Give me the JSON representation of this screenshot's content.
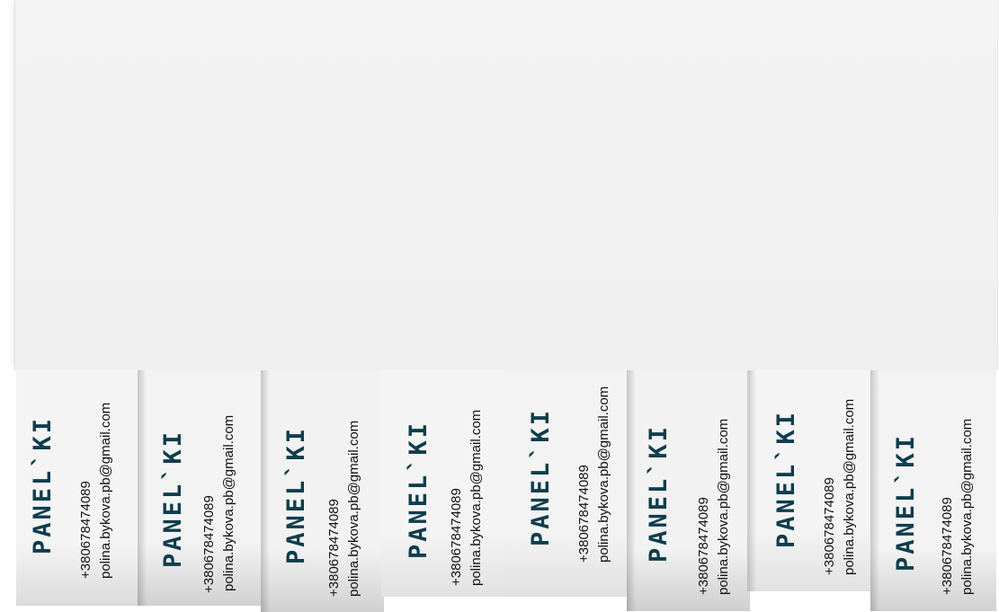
{
  "tabs": [
    {
      "brand": "PANEL`KI",
      "phone": "+380678474089",
      "email": "polina.bykova.pb@gmail.com"
    },
    {
      "brand": "PANEL`KI",
      "phone": "+380678474089",
      "email": "polina.bykova.pb@gmail.com"
    },
    {
      "brand": "PANEL`KI",
      "phone": "+380678474089",
      "email": "polina.bykova.pb@gmail.com"
    },
    {
      "brand": "PANEL`KI",
      "phone": "+380678474089",
      "email": "polina.bykova.pb@gmail.com"
    },
    {
      "brand": "PANEL`KI",
      "phone": "+380678474089",
      "email": "polina.bykova.pb@gmail.com"
    },
    {
      "brand": "PANEL`KI",
      "phone": "+380678474089",
      "email": "polina.bykova.pb@gmail.com"
    },
    {
      "brand": "PANEL`KI",
      "phone": "+380678474089",
      "email": "polina.bykova.pb@gmail.com"
    },
    {
      "brand": "PANEL`KI",
      "phone": "+380678474089",
      "email": "polina.bykova.pb@gmail.com"
    }
  ],
  "colors": {
    "brand": "#0f3d4c",
    "text": "#111111",
    "paper": "#f2f2f2"
  }
}
